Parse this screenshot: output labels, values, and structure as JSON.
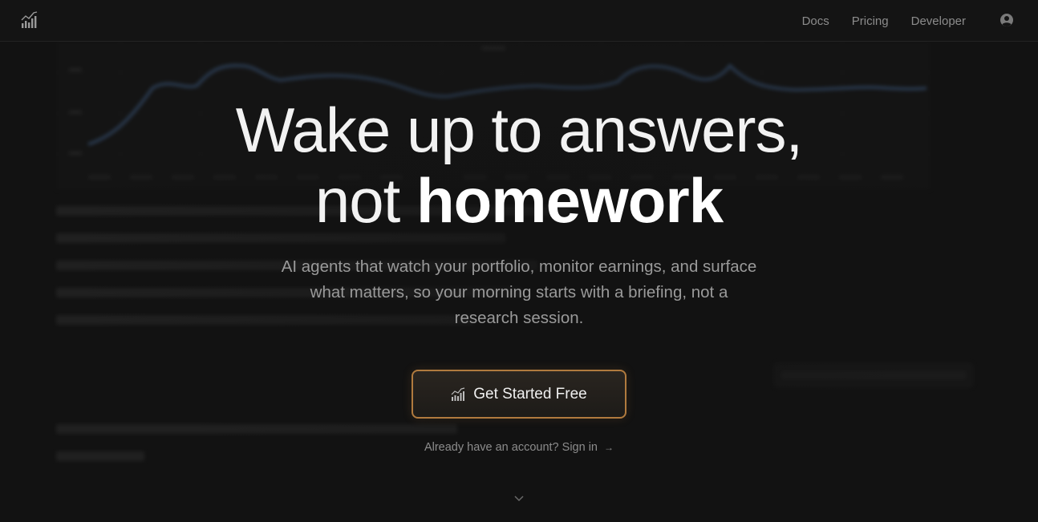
{
  "header": {
    "nav": [
      "Docs",
      "Pricing",
      "Developer"
    ],
    "logo_icon": "bar-chart-logo-icon",
    "account_icon": "user-circle-icon"
  },
  "hero": {
    "title_line1": "Wake up to answers,",
    "title_line2_regular": "not ",
    "title_line2_bold": "homework",
    "subtitle": "AI agents that watch your portfolio, monitor earnings, and surface what matters, so your morning starts with a briefing, not a research session.",
    "cta_label": "Get Started Free",
    "signin_text": "Already have an account? Sign in",
    "signin_arrow": "→",
    "scroll_icon": "chevron-down-icon"
  },
  "colors": {
    "background": "#121212",
    "accent_border": "#b07a3e",
    "chart_line": "#3d5a80"
  }
}
